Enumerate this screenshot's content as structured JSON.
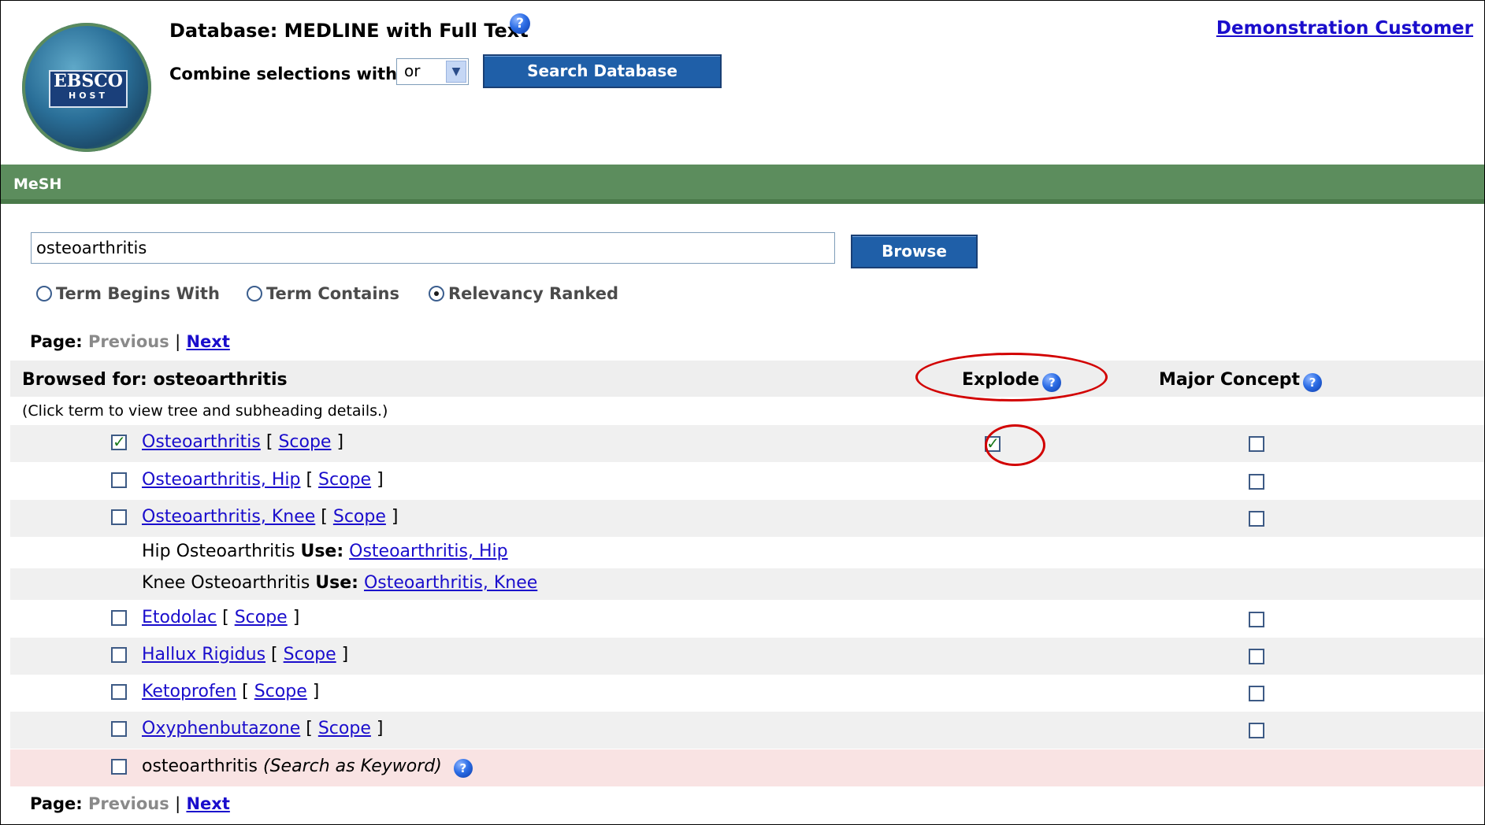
{
  "header": {
    "database_label": "Database: MEDLINE with Full Text",
    "combine_label": "Combine selections with:",
    "combine_value": "or",
    "search_button": "Search Database",
    "customer_link": "Demonstration Customer",
    "logo_line1": "EBSCO",
    "logo_line2": "HOST"
  },
  "section": {
    "title": "MeSH"
  },
  "browse": {
    "query": "osteoarthritis",
    "button": "Browse",
    "modes": [
      {
        "label": "Term Begins With",
        "selected": false
      },
      {
        "label": "Term Contains",
        "selected": false
      },
      {
        "label": "Relevancy Ranked",
        "selected": true
      }
    ]
  },
  "pager": {
    "page_label": "Page:",
    "previous": "Previous",
    "separator": "|",
    "next": "Next"
  },
  "results": {
    "browsed_for": "Browsed for: osteoarthritis",
    "hint": "(Click term to view tree and subheading details.)",
    "col_explode": "Explode",
    "col_major": "Major Concept",
    "scope_label": "Scope",
    "use_label": "Use:",
    "rows": [
      {
        "term": "Osteoarthritis",
        "selected": true,
        "explode": true
      },
      {
        "term": "Osteoarthritis, Hip"
      },
      {
        "term": "Osteoarthritis, Knee"
      },
      {
        "text": "Hip Osteoarthritis",
        "target": "Osteoarthritis, Hip"
      },
      {
        "text": "Knee Osteoarthritis",
        "target": "Osteoarthritis, Knee"
      },
      {
        "term": "Etodolac"
      },
      {
        "term": "Hallux Rigidus"
      },
      {
        "term": "Ketoprofen"
      },
      {
        "term": "Oxyphenbutazone"
      }
    ],
    "keyword_term": "osteoarthritis",
    "keyword_note": "(Search as Keyword)"
  },
  "icons": {
    "help": "help-icon",
    "dropdown": "chevron-down-icon"
  },
  "colors": {
    "mesh_bar": "#5c8d5d",
    "link": "#1a0dcc",
    "button": "#1f5fa8",
    "annotation": "#d20000"
  }
}
